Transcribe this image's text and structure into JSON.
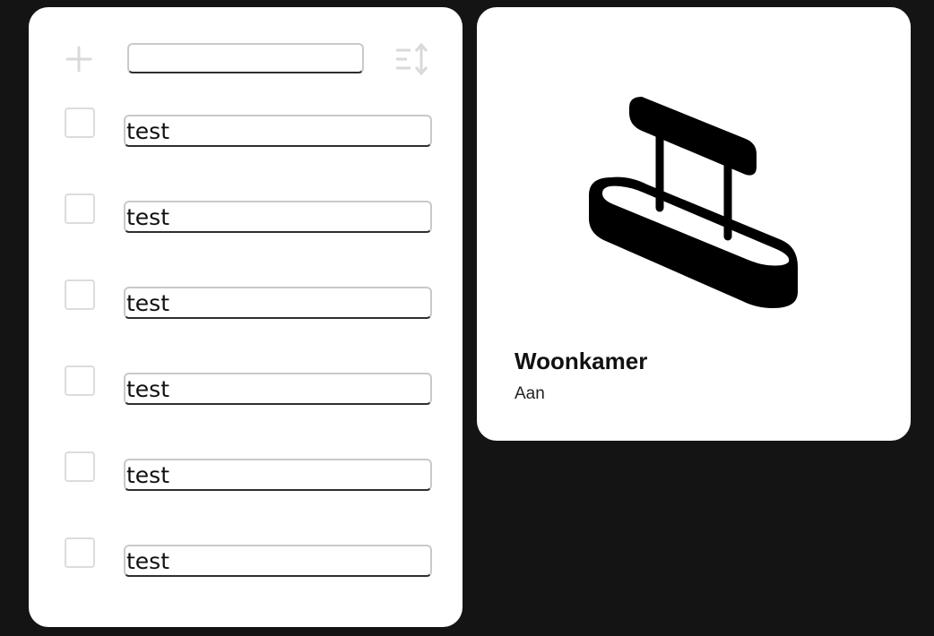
{
  "todo_card": {
    "add_icon": "plus-icon",
    "new_item_value": "",
    "sort_icon": "sort-icon",
    "items": [
      {
        "label": "test",
        "checked": false
      },
      {
        "label": "test",
        "checked": false
      },
      {
        "label": "test",
        "checked": false
      },
      {
        "label": "test",
        "checked": false
      },
      {
        "label": "test",
        "checked": false
      },
      {
        "label": "test",
        "checked": false
      }
    ]
  },
  "light_card": {
    "icon": "ceiling-lamp-icon",
    "name": "Woonkamer",
    "state": "Aan"
  },
  "colors": {
    "background": "#141414",
    "card": "#ffffff",
    "icon_muted": "#d9d9d9",
    "icon_active": "#000000"
  }
}
